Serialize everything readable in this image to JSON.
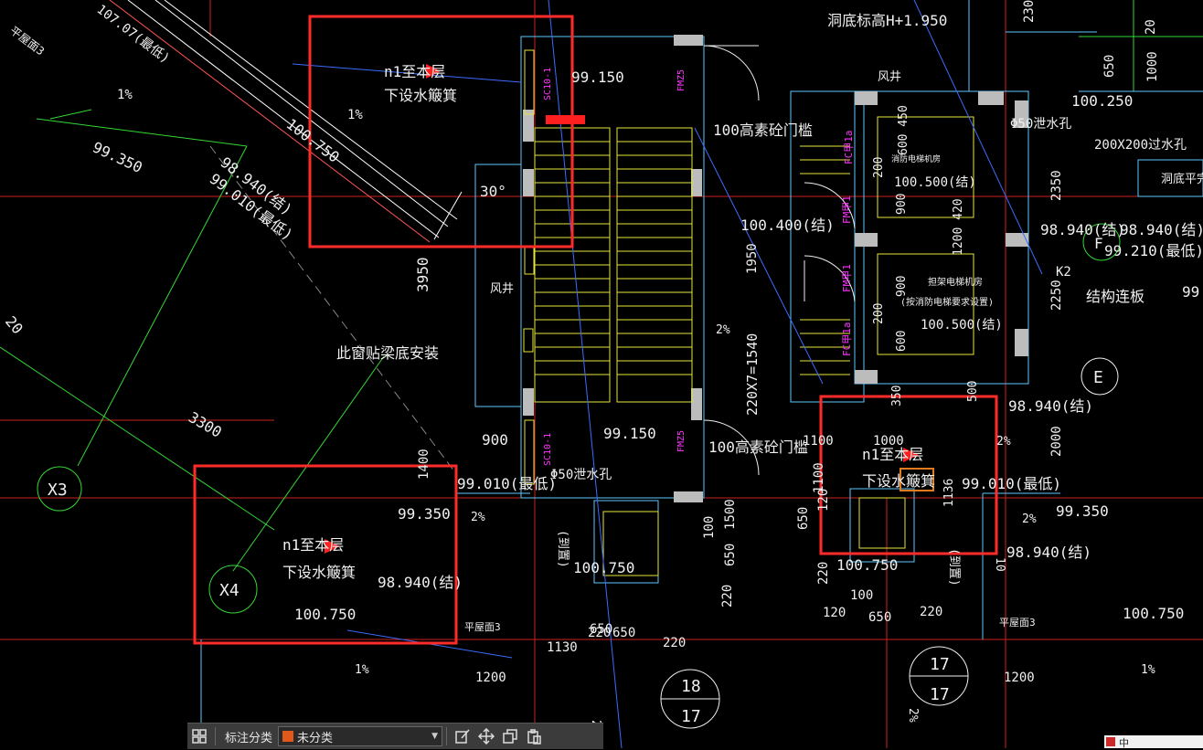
{
  "colors": {
    "red_box": "#ff2b2b",
    "yellow": "#e8e63a",
    "cyan": "#5cc8ff",
    "white": "#f0f0f0",
    "magenta": "#ff33ff",
    "green": "#35d835",
    "blue": "#3b6cff"
  },
  "labels": {
    "pingwu3_tl": "平屋面3",
    "v107_top": "107.07(最低)",
    "pct_1a": "1%",
    "pct_1b": "1%",
    "v100750a": "100.750",
    "v99350a": "99.350",
    "v98940a": "98.940(结)",
    "v99010a": "99.010(最低)",
    "note_n1a_1": "n1至本层",
    "note_n1a_2": "下设水簸箕",
    "v99150a": "99.150",
    "sc10_1a": "SC10-1",
    "fmz5a": "FMZ5",
    "hole_bottom": "洞底标高H+1.950",
    "fengjing_top": "风井",
    "d650": "650",
    "d1000": "1000",
    "v100250": "100.250",
    "d2300": "2300",
    "xieshuikong_a": "Φ50泄水孔",
    "menkan_a": "100高素砼门槛",
    "fcjia1a": "FC甲1a",
    "d600450": "600 450",
    "xiaofang_room": "消防电梯机房",
    "v100500a": "100.500(结)",
    "d200a": "200",
    "d900a": "900",
    "guoshui": "200X200过水孔",
    "hole_flat": "洞底平完",
    "d2350": "2350",
    "d30": "30°",
    "fmjia1a": "FM甲1",
    "v100400": "100.400(结)",
    "d1950": "1950",
    "d3950": "3950",
    "fengjing_left": "风井",
    "d1200420": "1200 420",
    "v98940b": "98.940(结)",
    "v98940c": "98.940(结)",
    "v99210": "99.210(最低)",
    "circle_f": "F",
    "k2": "K2",
    "jiegou": "结构连板",
    "d99r": "99",
    "d20l": "20",
    "fmjia1b": "FM甲1",
    "fcjia1b": "FC甲1a",
    "d200b": "200",
    "d600b": "600",
    "d900b": "900",
    "dianti_room_1": "担架电梯机房",
    "dianti_room_2": "(按消防电梯要求设置)",
    "v100500b": "100.500(结)",
    "d2250": "2250",
    "window_note": "此窗贴梁底安装",
    "pct_2a": "2%",
    "stairs": "220X7=1540",
    "circle_e": "E",
    "d350": "350",
    "d500": "500",
    "v98940d": "98.940(结)",
    "d2000": "2000",
    "d3300": "3300",
    "x3": "X3",
    "d900c": "900",
    "v99150b": "99.150",
    "d1100a": "1100",
    "d1000b": "1000",
    "note_n1b_1": "n1至本层",
    "note_n1b_2": "下设水簸箕",
    "pct_2b": "2%",
    "fmz5b": "FMZ5",
    "menkan_b": "100高素砼门槛",
    "sc10_1b": "SC10-1",
    "xieshuikong_b": "Φ50泄水孔",
    "d1100b": "1100",
    "v99010b": "99.010(最低)",
    "v99010c": "99.010(最低)",
    "v99350b": "99.350",
    "v99350c": "99.350",
    "pct_2c": "2%",
    "pct_2d": "2%",
    "note_n1c_1": "n1至本层",
    "note_n1c_2": "下设水簸箕",
    "x4": "X4",
    "v98940e": "98.940(结)",
    "v98940f": "98.940(结)",
    "v100750b": "100.750",
    "v100750c": "100.750",
    "v100750d": "100.750",
    "v100750e": "100.750",
    "jingkou_a": "(到置)",
    "jingkou_b": "(到置)",
    "d1500": "1500",
    "d650b": "650",
    "d100": "100",
    "d220a": "220",
    "d650c": "650",
    "d120a": "120",
    "d220b": "220",
    "d650d": "650",
    "d220c": "220",
    "d120b": "120",
    "d100b": "100",
    "d650e": "650",
    "d220d": "220",
    "pingwu3_a": "平屋面3",
    "pingwu3_b": "平屋面3",
    "d1130": "1130",
    "d220e": "220",
    "d650f": "650",
    "d220f": "220",
    "pct_1c": "1%",
    "pct_1d": "1%",
    "d1200a": "1200",
    "d1200b": "1200",
    "c18": "18",
    "c17a": "17",
    "c17b": "17",
    "c17c": "17",
    "pct_2e": "2%",
    "pct_2f": "2%",
    "d20": "20",
    "d1136": "1136",
    "d10": "10",
    "d1400": "1400"
  },
  "toolbar": {
    "grid_icon": "grid-icon",
    "category_label": "标注分类",
    "category_value": "未分类",
    "edit_icon": "edit-icon",
    "move_icon": "move-icon",
    "copy_icon": "copy-icon",
    "paste_icon": "paste-icon"
  },
  "ime": {
    "text": "中"
  }
}
